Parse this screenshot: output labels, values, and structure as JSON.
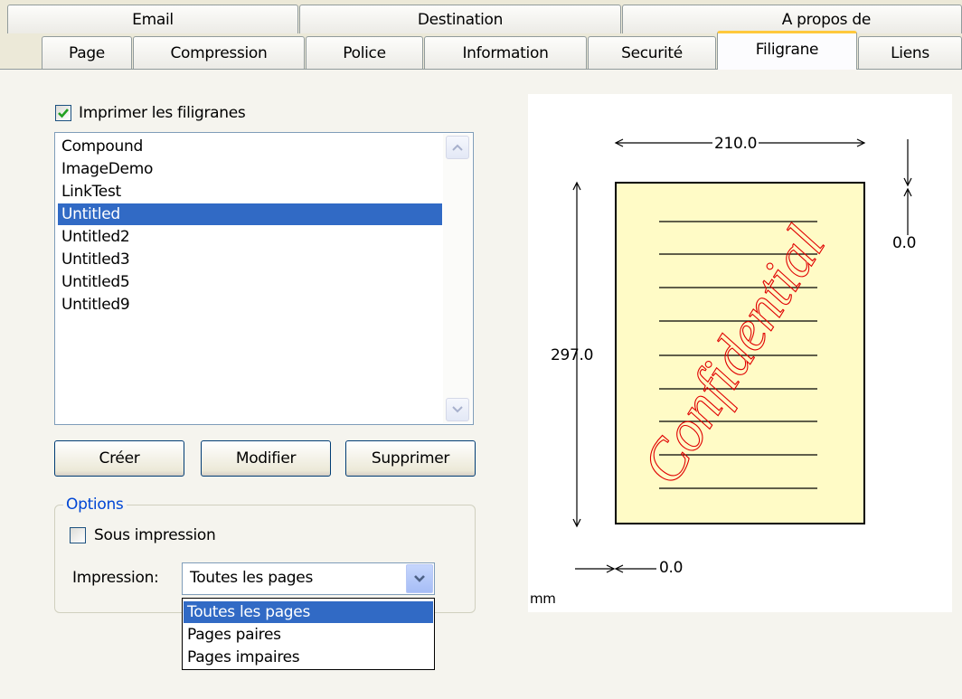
{
  "tabs": {
    "row1": [
      {
        "label": "Email"
      },
      {
        "label": "Destination"
      },
      {
        "label": "A propos de"
      }
    ],
    "row2": [
      {
        "label": "Page"
      },
      {
        "label": "Compression"
      },
      {
        "label": "Police"
      },
      {
        "label": "Information"
      },
      {
        "label": "Securité"
      },
      {
        "label": "Filigrane"
      },
      {
        "label": "Liens"
      }
    ],
    "active": "Filigrane"
  },
  "print_watermarks": {
    "label": "Imprimer les filigranes",
    "checked": true
  },
  "watermark_list": {
    "items": [
      "Compound",
      "ImageDemo",
      "LinkTest",
      "Untitled",
      "Untitled2",
      "Untitled3",
      "Untitled5",
      "Untitled9"
    ],
    "selected": "Untitled"
  },
  "buttons": {
    "create": "Créer",
    "modify": "Modifier",
    "delete": "Supprimer"
  },
  "options": {
    "title": "Options",
    "under_print": {
      "label": "Sous impression",
      "checked": false
    },
    "print_label": "Impression:",
    "print_value": "Toutes les pages",
    "print_options": [
      "Toutes les pages",
      "Pages paires",
      "Pages impaires"
    ]
  },
  "preview": {
    "width_value": "210.0",
    "height_value": "297.0",
    "top_offset": "0.0",
    "left_offset": "0.0",
    "unit": "mm",
    "watermark_text": "Confidential",
    "watermark_color": "#e00000",
    "page_color": "#fffbc6"
  },
  "icons": {
    "check": "check-icon",
    "scroll_up": "arrow-up-icon",
    "scroll_down": "arrow-down-icon",
    "combo": "chevron-down-icon"
  }
}
